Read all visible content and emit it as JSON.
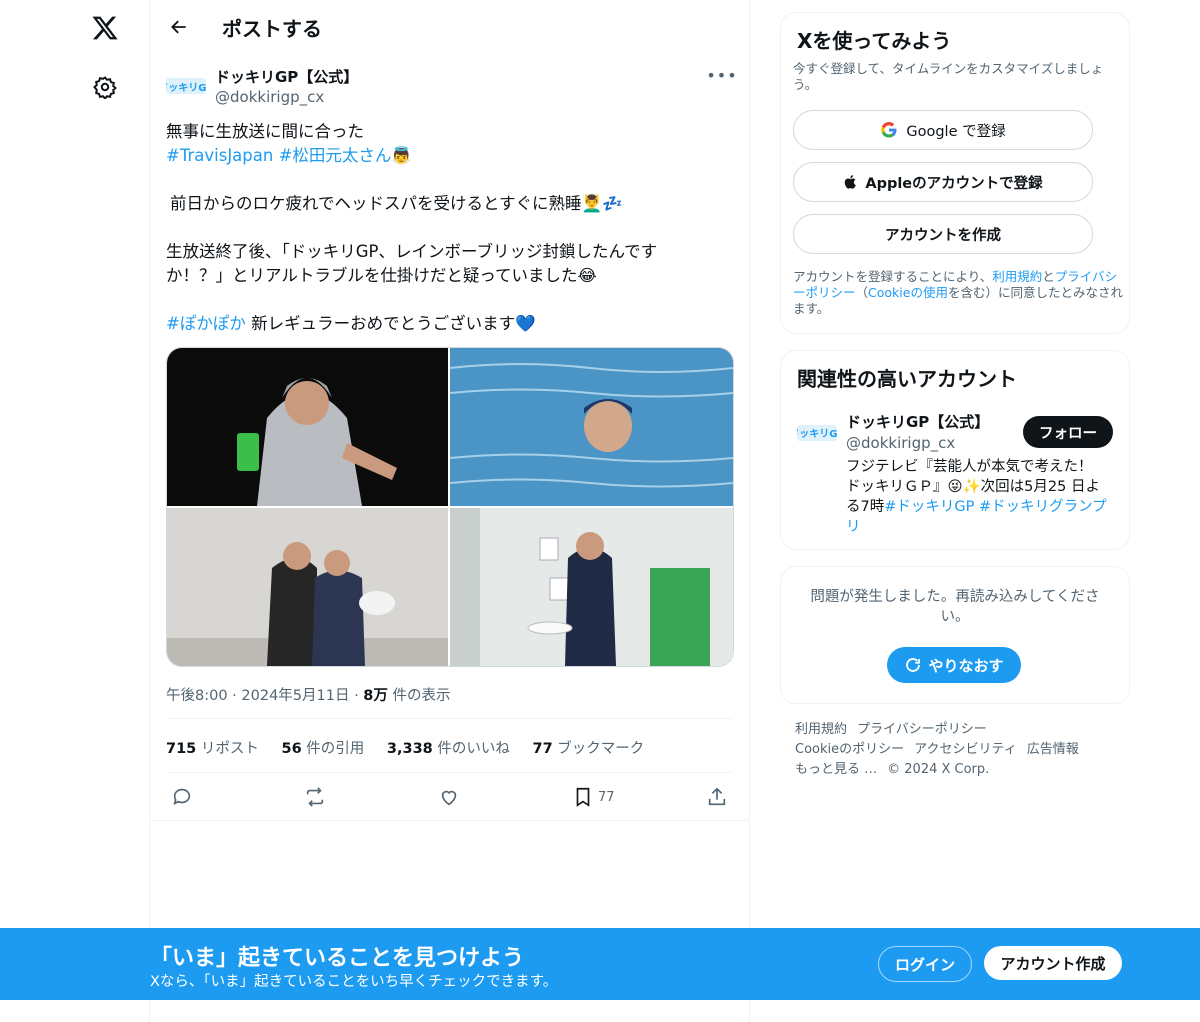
{
  "header": {
    "title": "ポストする"
  },
  "post": {
    "author_name": "ドッキリGP【公式】",
    "author_handle": "@dokkirigp_cx",
    "avatar_text": "ドッキリGP",
    "line1": "無事に生放送に間に合った",
    "hashtag_line": "#TravisJapan #松田元太さん",
    "emoji_angel": "👼",
    "line2": "前日からのロケ疲れでヘッドスパを受けるとすぐに熟睡",
    "emoji_sleep": "💆‍♂️💤",
    "line3": "生放送終了後、「ドッキリGP、レインボーブリッジ封鎖したんです",
    "line4": "か！？」とリアルトラブルを仕掛けだと疑っていました",
    "emoji_laugh": "😂",
    "hashtag_popo": "#ぽかぽか",
    "line5": "新レギュラーおめでとうございます",
    "emoji_heart": "💙",
    "time": "午後8:00",
    "date": "2024年5月11日",
    "sep": "·",
    "views_count": "8万",
    "views_label": "件の表示",
    "stats": [
      {
        "count": "715",
        "label": "リポスト"
      },
      {
        "count": "56",
        "label": "件の引用"
      },
      {
        "count": "3,338",
        "label": "件のいいね"
      },
      {
        "count": "77",
        "label": "ブックマーク"
      }
    ],
    "bookmark_count": "77"
  },
  "signup": {
    "title": "Xを使ってみよう",
    "subtitle": "今すぐ登録して、タイムラインをカスタマイズしましょう。",
    "google_label": "Google で登録",
    "apple_label": "Appleのアカウントで登録",
    "create_label": "アカウントを作成",
    "legal_1": "アカウントを登録することにより、",
    "legal_terms": "利用規約",
    "legal_and": "と",
    "legal_privacy": "プライバシーポリシー",
    "legal_2": "（",
    "legal_cookie": "Cookieの使用",
    "legal_3": "を含む）に同意したとみなされます。"
  },
  "related": {
    "title": "関連性の高いアカウント",
    "name": "ドッキリGP【公式】",
    "handle": "@dokkirigp_cx",
    "follow_label": "フォロー",
    "bio_1": "フジテレビ『芸能人が本気で考えた！",
    "bio_2": "ドッキリＧＰ』😜✨次回は5月25 日よ",
    "bio_3a": "る7時",
    "bio_3b": "#ドッキリGP #ドッキリグランプ",
    "bio_4": "リ"
  },
  "error": {
    "message": "問題が発生しました。再読み込みしてください。",
    "retry_label": "やりなおす"
  },
  "footer": {
    "links": [
      "利用規約",
      "プライバシーポリシー",
      "Cookieのポリシー",
      "アクセシビリティ",
      "広告情報",
      "もっと見る …",
      "© 2024 X Corp."
    ]
  },
  "banner": {
    "title": "「いま」起きていることを見つけよう",
    "subtitle": "Xなら、「いま」起きていることをいち早くチェックできます。",
    "login_label": "ログイン",
    "signup_label": "アカウント作成"
  },
  "colors": {
    "accent": "#1d9bf0",
    "text": "#0f1419",
    "muted": "#536471"
  },
  "icons": [
    "x-logo-icon",
    "settings-icon",
    "back-arrow-icon",
    "more-icon",
    "reply-icon",
    "repost-icon",
    "like-icon",
    "bookmark-icon",
    "share-icon",
    "google-icon",
    "apple-icon",
    "refresh-icon"
  ]
}
